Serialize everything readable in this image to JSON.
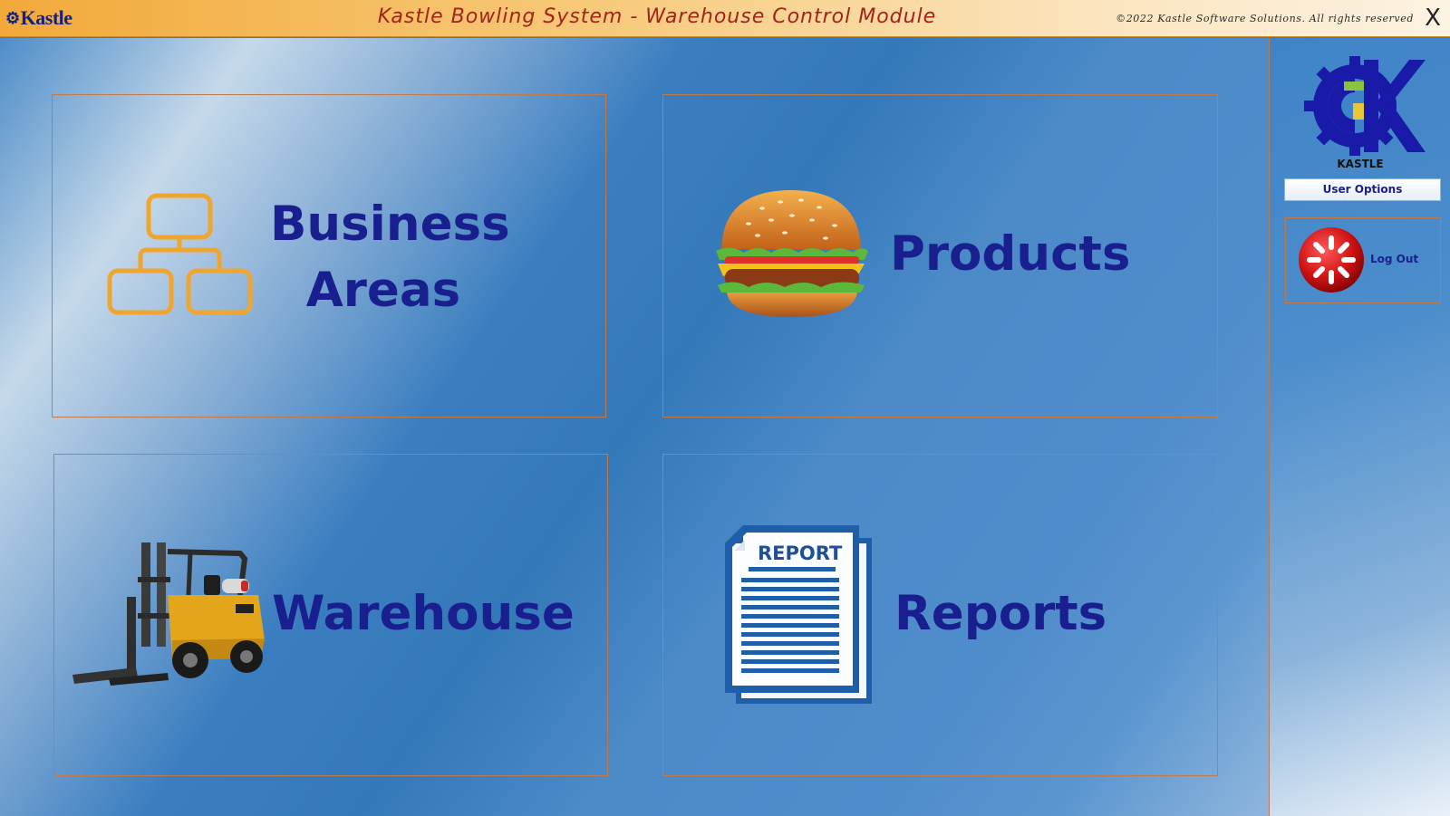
{
  "titlebar": {
    "brand": "Kastle",
    "title": "Kastle Bowling System - Warehouse Control Module",
    "copyright": "©2022 Kastle Software Solutions. All rights reserved",
    "close_label": "X"
  },
  "tiles": {
    "business": {
      "line1": "Business",
      "line2": "Areas",
      "icon": "org-chart-icon"
    },
    "products": {
      "label": "Products",
      "icon": "hamburger-icon"
    },
    "warehouse": {
      "label": "Warehouse",
      "icon": "forklift-icon"
    },
    "reports": {
      "label": "Reports",
      "icon": "report-document-icon",
      "doc_heading": "REPORT"
    }
  },
  "sidebar": {
    "logo_text": "KASTLE",
    "user_options": "User Options",
    "logout": "Log Out"
  },
  "colors": {
    "accent_text": "#1a1f8f",
    "title_text": "#a3231b",
    "tile_border": "#c07a49",
    "titlebar_orange": "#f2a93a"
  }
}
